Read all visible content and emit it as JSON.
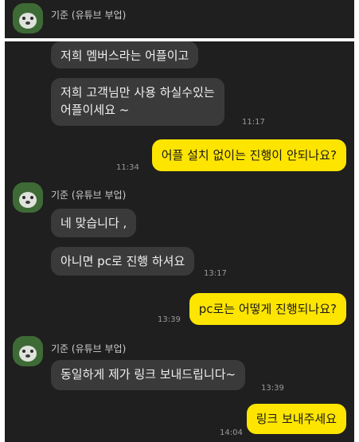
{
  "contact": {
    "name": "기준 (유튜브 부업)"
  },
  "messages": [
    {
      "dir": "in",
      "text": "저희 멤버스라는 어플이고"
    },
    {
      "dir": "in",
      "line1": "저희 고객님만 사용 하실수있는",
      "line2": "어플이세요 ~",
      "time": "11:17"
    },
    {
      "dir": "out",
      "text": "어플 설치 없이는 진행이 안되나요?",
      "time": "11:34"
    },
    {
      "dir": "in",
      "text": "네 맞습니다 ,"
    },
    {
      "dir": "in",
      "text": "아니면 pc로 진행 하셔요",
      "time": "13:17"
    },
    {
      "dir": "out",
      "text": "pc로는 어떻게 진행되나요?",
      "time": "13:39"
    },
    {
      "dir": "in",
      "text": "동일하게 제가 링크 보내드립니다~",
      "time": "13:39"
    },
    {
      "dir": "out",
      "text": "링크 보내주세요",
      "time": "14:04"
    }
  ],
  "colors": {
    "background": "#1f1f1f",
    "incoming_bubble": "#3a3a3a",
    "outgoing_bubble": "#fee500"
  }
}
